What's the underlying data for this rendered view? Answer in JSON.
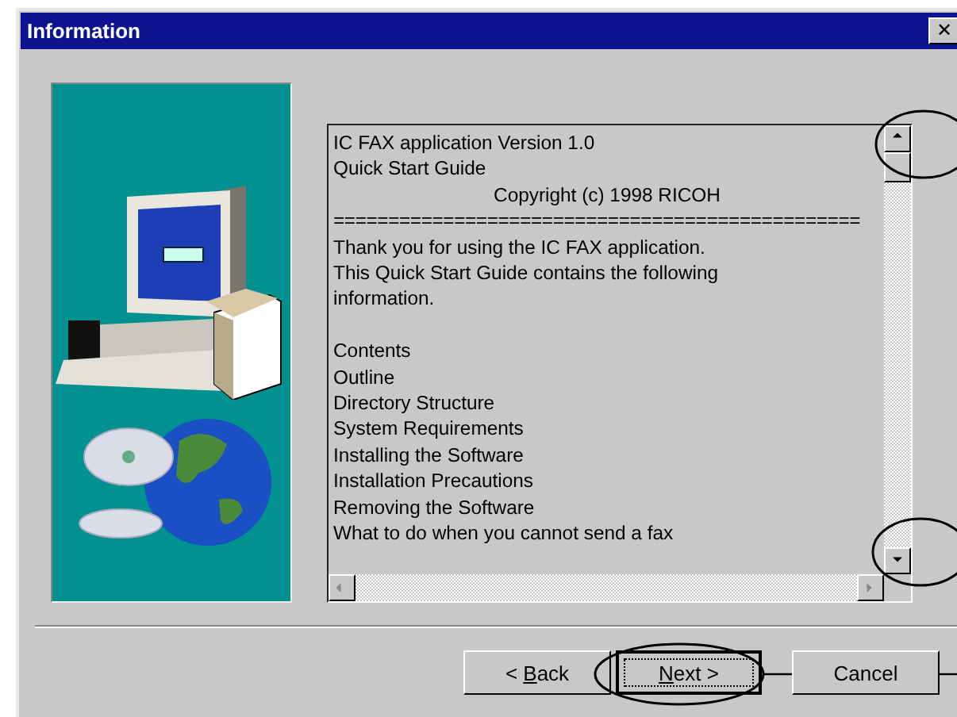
{
  "window": {
    "title": "Information",
    "close_glyph": "✕"
  },
  "readme": {
    "lines": [
      {
        "kind": "line",
        "text": "IC FAX application Version 1.0",
        "gap_before": false
      },
      {
        "kind": "line",
        "text": "Quick Start Guide",
        "gap_before": false
      },
      {
        "kind": "centered",
        "text": "Copyright (c) 1998 RICOH",
        "gap_before": false
      },
      {
        "kind": "rule",
        "text": "================================================",
        "gap_before": false
      },
      {
        "kind": "line",
        "text": "Thank you for using the IC FAX application.",
        "gap_before": false
      },
      {
        "kind": "line",
        "text": "This Quick Start Guide contains the following",
        "gap_before": false
      },
      {
        "kind": "line",
        "text": "information.",
        "gap_before": false
      },
      {
        "kind": "line",
        "text": "Contents",
        "gap_before": true
      },
      {
        "kind": "line",
        "text": "Outline",
        "gap_before": false
      },
      {
        "kind": "line",
        "text": "Directory Structure",
        "gap_before": false
      },
      {
        "kind": "line",
        "text": "System Requirements",
        "gap_before": false
      },
      {
        "kind": "line",
        "text": "Installing the Software",
        "gap_before": false
      },
      {
        "kind": "line",
        "text": "Installation Precautions",
        "gap_before": false
      },
      {
        "kind": "line",
        "text": "Removing the Software",
        "gap_before": false
      },
      {
        "kind": "line",
        "text": "What to do when you cannot send a fax",
        "gap_before": false
      }
    ]
  },
  "buttons": [
    {
      "before": "< ",
      "key": "B",
      "after": "ack",
      "focused": false
    },
    {
      "key": "N",
      "after": "ext >",
      "focused": true
    },
    {
      "after": "Cancel",
      "focused": false
    }
  ]
}
